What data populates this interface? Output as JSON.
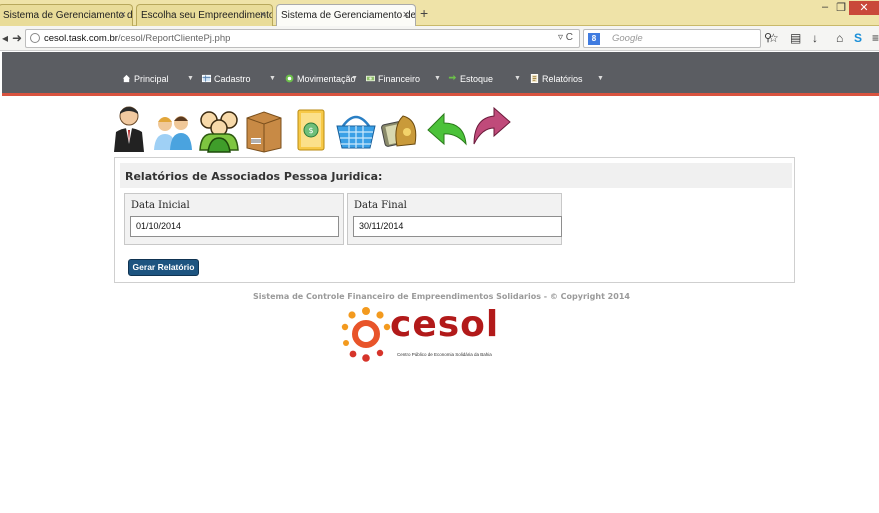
{
  "browser": {
    "tabs": [
      {
        "title": "Sistema de Gerenciamento de ...",
        "close": "×"
      },
      {
        "title": "Escolha seu Empreendimento S...",
        "close": "×"
      },
      {
        "title": "Sistema de Gerenciamento de ...",
        "close": "×"
      }
    ],
    "new_tab": "+",
    "window_controls": {
      "minimize": "–",
      "maximize": "❐",
      "close": "✕"
    },
    "url_host": "cesol.task.com.br",
    "url_path": "/cesol/ReportClientePj.php",
    "url_prefix": "cesol.",
    "search_placeholder": "Google",
    "search_engine_badge": "8"
  },
  "menu": {
    "items": [
      {
        "label": "Principal",
        "icon": "home-icon"
      },
      {
        "label": "Cadastro",
        "icon": "table-icon"
      },
      {
        "label": "Movimentação",
        "icon": "cycle-icon"
      },
      {
        "label": "Financeiro",
        "icon": "money-icon"
      },
      {
        "label": "Estoque",
        "icon": "arrows-icon"
      },
      {
        "label": "Relatórios",
        "icon": "report-icon"
      }
    ],
    "caret": "▼"
  },
  "shortcuts": [
    {
      "name": "businessman-icon"
    },
    {
      "name": "people-pair-icon"
    },
    {
      "name": "people-group-icon"
    },
    {
      "name": "package-box-icon"
    },
    {
      "name": "folder-coins-icon"
    },
    {
      "name": "shopping-basket-icon"
    },
    {
      "name": "money-bag-icon"
    },
    {
      "name": "back-arrow-icon"
    },
    {
      "name": "forward-arrow-icon"
    }
  ],
  "report": {
    "title": "Relatórios de Associados Pessoa Juridica:",
    "start_label": "Data Inicial",
    "start_value": "01/10/2014",
    "end_label": "Data Final",
    "end_value": "30/11/2014",
    "button_label": "Gerar Relatório"
  },
  "footer": {
    "text": "Sistema de Controle Financeiro de Empreendimentos Solidarios - © Copyright 2014",
    "logo_word": "cesol",
    "logo_tagline": "Centro Público de Economia Solidária da Bahia"
  },
  "colors": {
    "header_bg": "#5b5d62",
    "header_accent": "#d9533f",
    "button_bg": "#1d5480",
    "logo_red": "#b21a1a",
    "tab_strip": "#efe3a8"
  }
}
